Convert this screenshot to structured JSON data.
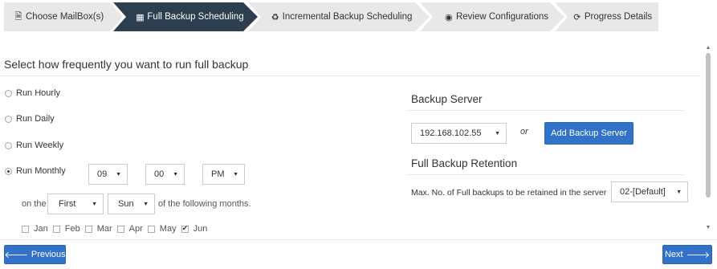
{
  "wizard": {
    "steps": [
      {
        "label": "Choose MailBox(s)",
        "icon": "document-icon",
        "glyph": "🗎"
      },
      {
        "label": "Full Backup Scheduling",
        "icon": "calendar-icon",
        "glyph": "▦"
      },
      {
        "label": "Incremental Backup Scheduling",
        "icon": "recycle-icon",
        "glyph": "♻"
      },
      {
        "label": "Review Configurations",
        "icon": "eye-icon",
        "glyph": "◉"
      },
      {
        "label": "Progress Details",
        "icon": "refresh-icon",
        "glyph": "⟳"
      }
    ],
    "active_step": 1,
    "active_color": "#2c3e50",
    "inactive_color": "#e8e8e8"
  },
  "main": {
    "heading": "Select how frequently you want to run full backup",
    "frequency": {
      "options": [
        "Run Hourly",
        "Run Daily",
        "Run Weekly",
        "Run Monthly"
      ],
      "selected": "Run Monthly"
    },
    "time": {
      "hour": "09",
      "minute": "00",
      "ampm": "PM"
    },
    "on_the_label": "on the",
    "week_ordinal": "First",
    "weekday": "Sun",
    "following_months_label": "of the following months.",
    "months": [
      {
        "label": "Jan",
        "checked": false
      },
      {
        "label": "Feb",
        "checked": false
      },
      {
        "label": "Mar",
        "checked": false
      },
      {
        "label": "Apr",
        "checked": false
      },
      {
        "label": "May",
        "checked": false
      },
      {
        "label": "Jun",
        "checked": true
      }
    ]
  },
  "backup_server": {
    "title": "Backup Server",
    "selected_server": "192.168.102.55",
    "or_label": "or",
    "add_button": "Add Backup Server"
  },
  "retention": {
    "title": "Full Backup Retention",
    "label": "Max. No. of Full backups to be retained in the server",
    "value": "02-[Default]"
  },
  "footer": {
    "previous": "Previous",
    "next": "Next",
    "button_color": "#3273c9"
  }
}
